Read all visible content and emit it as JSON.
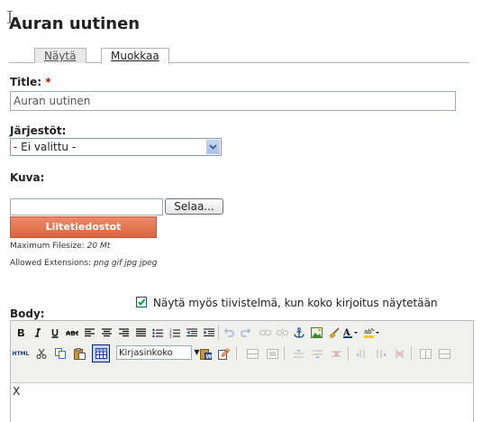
{
  "page": {
    "title": "Auran uutinen"
  },
  "tabs": [
    {
      "label": "Näytä",
      "active": false
    },
    {
      "label": "Muokkaa",
      "active": true
    }
  ],
  "form": {
    "title_label": "Title:",
    "required_mark": "*",
    "title_value": "Auran uutinen",
    "org_label": "Järjestöt:",
    "org_selected": "- Ei valittu -",
    "image_label": "Kuva:",
    "file_value": "",
    "browse_label": "Selaa...",
    "attachments_button": "Liitetiedostot",
    "max_filesize_label": "Maximum Filesize:",
    "max_filesize_value": "20 Mt",
    "allowed_ext_label": "Allowed Extensions:",
    "allowed_ext_value": "png gif jpg jpeg",
    "body_label": "Body:",
    "summary_checkbox_label": "Näytä myös tiivistelmä, kun koko kirjoitus näytetään",
    "summary_checked": true
  },
  "editor": {
    "font_size_combo": "Kirjasinkoko",
    "content": "X",
    "toolbar_row1": [
      "bold-icon",
      "italic-icon",
      "underline-icon",
      "strikethrough-icon",
      "align-left-icon",
      "align-center-icon",
      "align-right-icon",
      "align-justify-icon",
      "bullet-list-icon",
      "numbered-list-icon",
      "outdent-icon",
      "indent-icon",
      "undo-icon",
      "redo-icon",
      "link-icon",
      "unlink-icon",
      "anchor-icon",
      "image-icon",
      "cleanup-icon",
      "text-color-icon",
      "highlight-color-icon"
    ],
    "toolbar_row2": [
      "html-source-icon",
      "cut-icon",
      "copy-icon",
      "paste-icon",
      "table-icon",
      "font-size-select",
      "paste-word-icon",
      "edit-icon"
    ],
    "html_icon_text": "HTML",
    "colors": {
      "accent": "#e07550",
      "tab_border": "#b7b7b7"
    }
  }
}
